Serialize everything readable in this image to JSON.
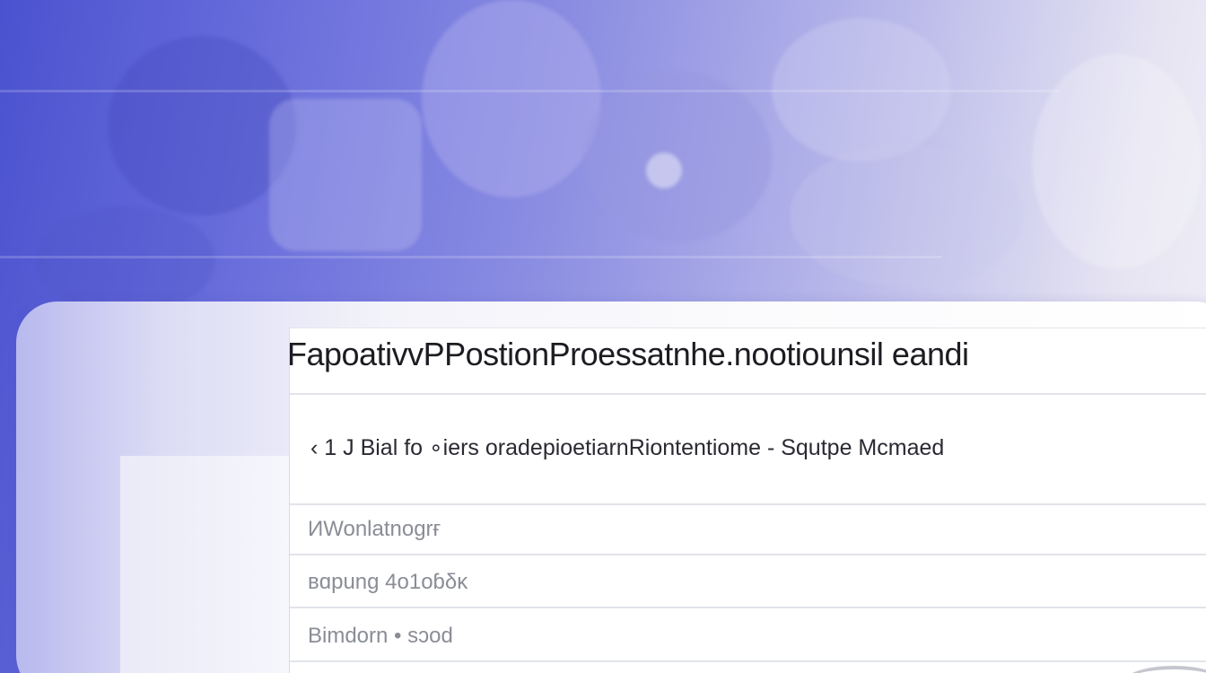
{
  "dialog": {
    "title": "FapoativvPPostionProessatnhe.nootiounsil eandi",
    "subtitle": "‹ 1 J  Bial  fo ∘iers  oradepioetiarnRiontentiome  -  Squtpe  Mcmaed"
  },
  "rows": [
    {
      "label": "ИWonlatnogrғ"
    },
    {
      "label": "ʙɑpung  4o1oɓδĸ"
    },
    {
      "label": "Bimdorn • sɔod"
    }
  ]
}
